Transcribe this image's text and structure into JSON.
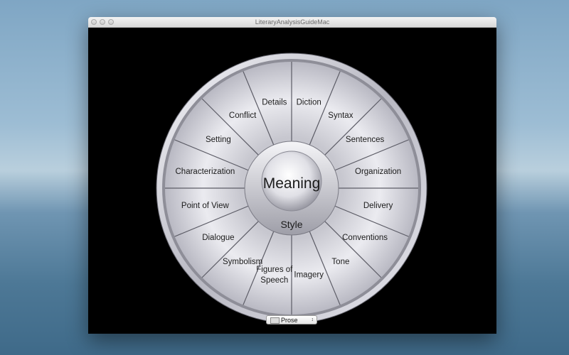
{
  "window": {
    "title": "LiteraryAnalysisGuideMac"
  },
  "wheel": {
    "center_label": "Meaning",
    "inner_label": "Style",
    "segments": [
      {
        "label": "Details"
      },
      {
        "label": "Diction"
      },
      {
        "label": "Syntax"
      },
      {
        "label": "Sentences"
      },
      {
        "label": "Organization"
      },
      {
        "label": "Delivery"
      },
      {
        "label": "Conventions"
      },
      {
        "label": "Tone"
      },
      {
        "label": "Imagery"
      },
      {
        "label": "Figures of\nSpeech"
      },
      {
        "label": "Symbolism"
      },
      {
        "label": "Dialogue"
      },
      {
        "label": "Point of View"
      },
      {
        "label": "Characterization"
      },
      {
        "label": "Setting"
      },
      {
        "label": "Conflict"
      }
    ]
  },
  "popup": {
    "selected": "Prose",
    "icon": "document-icon",
    "chevron": "↕"
  }
}
